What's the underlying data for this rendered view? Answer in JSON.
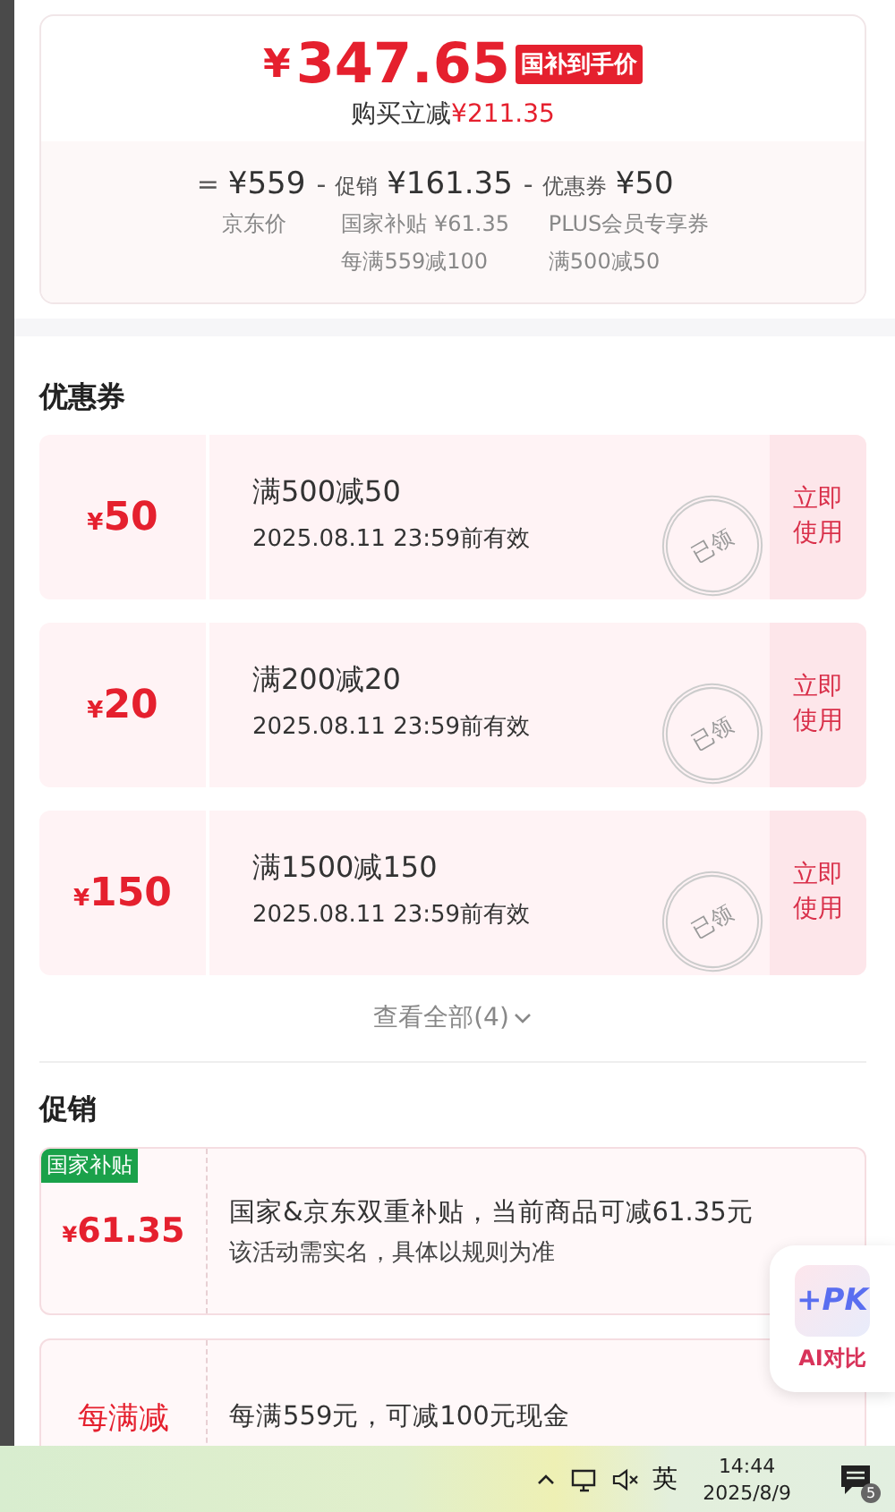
{
  "summary": {
    "price_symbol": "¥",
    "price": "347.65",
    "price_tag": "国补到手价",
    "saving_label": "购买立减",
    "saving": "¥211.35",
    "breakdown": [
      {
        "operator": "=",
        "amount": "¥559",
        "notes": [
          "京东价"
        ]
      },
      {
        "operator": "-",
        "label": "促销",
        "amount": "¥161.35",
        "notes": [
          "国家补贴 ¥61.35",
          "每满559减100"
        ]
      },
      {
        "operator": "-",
        "label": "优惠券",
        "amount": "¥50",
        "notes": [
          "PLUS会员专享券",
          "满500减50"
        ]
      }
    ]
  },
  "coupons": {
    "title": "优惠券",
    "items": [
      {
        "symbol": "¥",
        "amount": "50",
        "condition": "满500减50",
        "validity": "2025.08.11 23:59前有效",
        "action": "立即使用",
        "claimed_stamp": "已领"
      },
      {
        "symbol": "¥",
        "amount": "20",
        "condition": "满200减20",
        "validity": "2025.08.11 23:59前有效",
        "action": "立即使用",
        "claimed_stamp": "已领"
      },
      {
        "symbol": "¥",
        "amount": "150",
        "condition": "满1500减150",
        "validity": "2025.08.11 23:59前有效",
        "action": "立即使用",
        "claimed_stamp": "已领"
      }
    ],
    "view_all": "查看全部(4)"
  },
  "promotions": {
    "title": "促销",
    "items": [
      {
        "kind": "amount",
        "badge": "国家补贴",
        "symbol": "¥",
        "value": "61.35",
        "description": "国家&京东双重补贴，当前商品可减61.35元",
        "note": "该活动需实名，具体以规则为准"
      },
      {
        "kind": "label",
        "value": "每满减",
        "description": "每满559元，可减100元现金"
      }
    ]
  },
  "floating": {
    "logo": "+PK",
    "label": "AI对比"
  },
  "taskbar": {
    "ime": "英",
    "time": "14:44",
    "date": "2025/8/9",
    "notification_count": "5"
  }
}
